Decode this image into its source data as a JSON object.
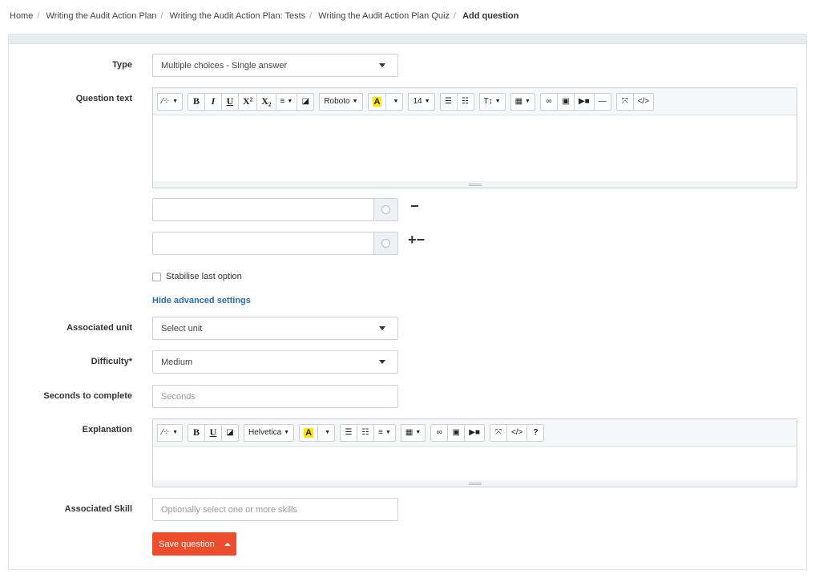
{
  "breadcrumb": {
    "items": [
      "Home",
      "Writing the Audit Action Plan",
      "Writing the Audit Action Plan: Tests",
      "Writing the Audit Action Plan Quiz"
    ],
    "current": "Add question"
  },
  "form": {
    "type_label": "Type",
    "type_value": "Multiple choices - Single answer",
    "question_text_label": "Question text",
    "question_toolbar": {
      "font": "Roboto",
      "size": "14",
      "highlight": "A",
      "superscript": "X²",
      "subscript": "X₂",
      "heading": "T↕"
    },
    "answer_remove": "−",
    "answer_add_remove": "+−",
    "stabilise_label": "Stabilise last option",
    "advanced_link": "Hide advanced settings",
    "unit_label": "Associated unit",
    "unit_value": "Select unit",
    "difficulty_label": "Difficulty*",
    "difficulty_value": "Medium",
    "seconds_label": "Seconds to complete",
    "seconds_placeholder": "Seconds",
    "explanation_label": "Explanation",
    "explanation_toolbar": {
      "font": "Helvetica",
      "highlight": "A",
      "help": "?"
    },
    "skill_label": "Associated Skill",
    "skill_placeholder": "Optionally select one or more skills",
    "save_label": "Save question"
  },
  "colors": {
    "accent": "#ee4d2d",
    "link": "#2a6db0"
  }
}
